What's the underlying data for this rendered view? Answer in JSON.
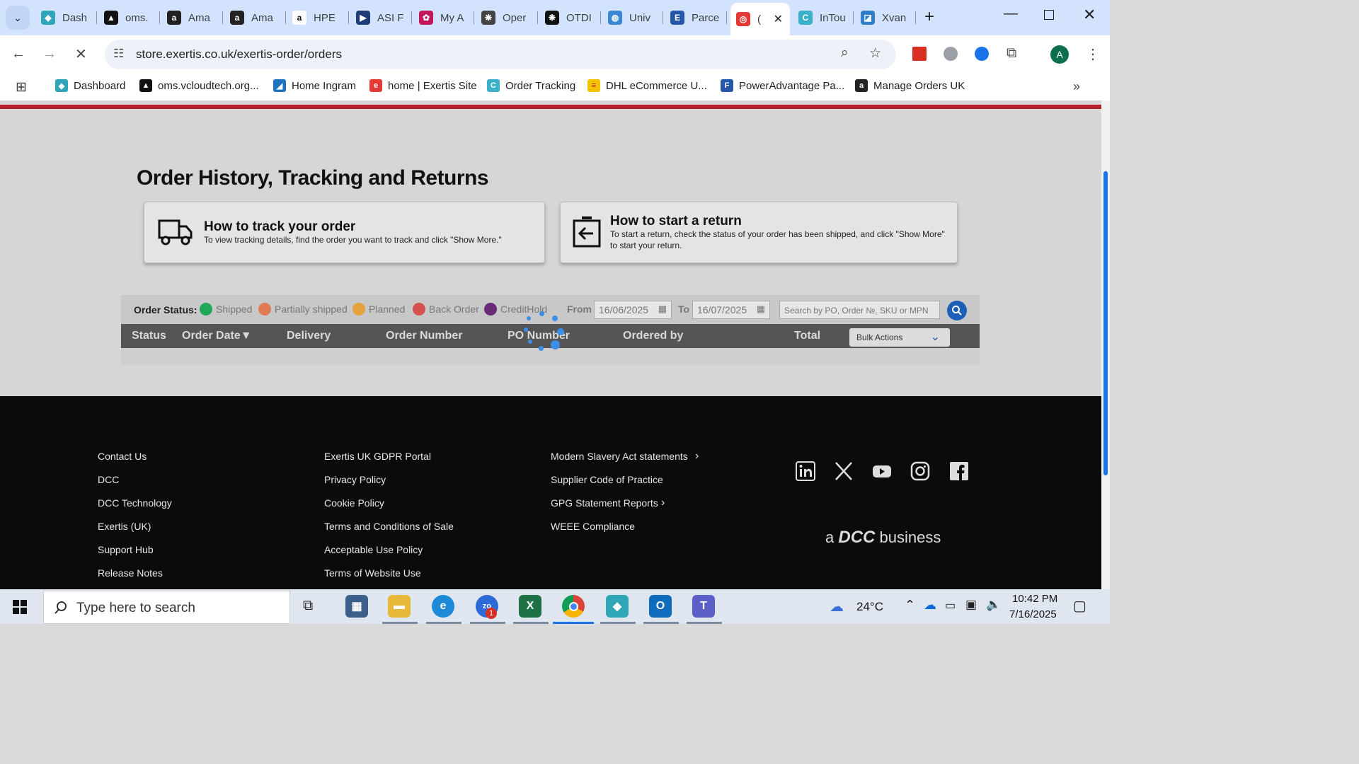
{
  "browser": {
    "tabs": [
      {
        "label": "Dash",
        "color": "#2fa6b8",
        "glyph": "◆"
      },
      {
        "label": "oms.",
        "color": "#111111",
        "glyph": "▲"
      },
      {
        "label": "Ama",
        "color": "#222222",
        "glyph": "a"
      },
      {
        "label": "Ama",
        "color": "#222222",
        "glyph": "a"
      },
      {
        "label": "HPE",
        "color": "#ffffff",
        "glyph": "a"
      },
      {
        "label": "ASI F",
        "color": "#1d3c78",
        "glyph": "▶"
      },
      {
        "label": "My A",
        "color": "#c2185b",
        "glyph": "✿"
      },
      {
        "label": "Oper",
        "color": "#444444",
        "glyph": "❋"
      },
      {
        "label": "OTDI",
        "color": "#111111",
        "glyph": "❋"
      },
      {
        "label": "Univ",
        "color": "#3b88d6",
        "glyph": "◍"
      },
      {
        "label": "Parce",
        "color": "#2556a8",
        "glyph": "E"
      },
      {
        "label": "(",
        "color": "#e53935",
        "glyph": "◎"
      },
      {
        "label": "InTou",
        "color": "#3ab0c9",
        "glyph": "C"
      },
      {
        "label": "Xvan",
        "color": "#2f7ec9",
        "glyph": "◪"
      }
    ],
    "active_tab_index": 11,
    "url": "store.exertis.co.uk/exertis-order/orders",
    "profile_initial": "A",
    "bookmarks": [
      {
        "label": "Dashboard",
        "color": "#2fa6b8",
        "glyph": "◆"
      },
      {
        "label": "oms.vcloudtech.org...",
        "color": "#111111",
        "glyph": "▲"
      },
      {
        "label": "Home Ingram",
        "color": "#1e73be",
        "glyph": "◢"
      },
      {
        "label": "home | Exertis Site",
        "color": "#e53935",
        "glyph": "e"
      },
      {
        "label": "Order Tracking",
        "color": "#3ab0c9",
        "glyph": "C"
      },
      {
        "label": "DHL eCommerce U...",
        "color": "#f5c400",
        "glyph": "≡"
      },
      {
        "label": "PowerAdvantage Pa...",
        "color": "#2556a8",
        "glyph": "F"
      },
      {
        "label": "Manage Orders UK",
        "color": "#222222",
        "glyph": "a"
      }
    ]
  },
  "page": {
    "title": "Order History, Tracking and Returns",
    "track_card": {
      "heading": "How to track your order",
      "text": "To view tracking details, find the order you want to track and click \"Show More.\""
    },
    "return_card": {
      "heading": "How to start a return",
      "text": "To start a return, check the status of your order has been shipped, and click \"Show More\" to start your return."
    },
    "filters": {
      "status_label": "Order Status:",
      "statuses": [
        {
          "label": "Shipped",
          "color": "#1fa85a"
        },
        {
          "label": "Partially shipped",
          "color": "#e07b55"
        },
        {
          "label": "Planned",
          "color": "#e3a23b"
        },
        {
          "label": "Back Order",
          "color": "#d4514f"
        },
        {
          "label": "CreditHold",
          "color": "#6a2a7a"
        }
      ],
      "from_label": "From",
      "from_value": "16/06/2025",
      "to_label": "To",
      "to_value": "16/07/2025",
      "search_placeholder": "Search by PO, Order №, SKU or MPN"
    },
    "table": {
      "columns": [
        "Status",
        "Order Date▼",
        "Delivery",
        "Order Number",
        "PO Number",
        "Ordered by",
        "Total"
      ],
      "bulk_actions": "Bulk Actions"
    },
    "footer": {
      "col1": [
        "Contact Us",
        "DCC",
        "DCC Technology",
        "Exertis (UK)",
        "Support Hub",
        "Release Notes"
      ],
      "col2": [
        "Exertis UK GDPR Portal",
        "Privacy Policy",
        "Cookie Policy",
        "Terms and Conditions of Sale",
        "Acceptable Use Policy",
        "Terms of Website Use"
      ],
      "col3": [
        "Modern Slavery Act statements",
        "Supplier Code of Practice",
        "GPG Statement Reports",
        "WEEE Compliance"
      ],
      "social": [
        "linkedin-icon",
        "x-icon",
        "youtube-icon",
        "instagram-icon",
        "facebook-icon"
      ],
      "tagline_a": "a",
      "tagline_dcc": "DCC",
      "tagline_rest": "business"
    }
  },
  "taskbar": {
    "search_placeholder": "Type here to search",
    "weather": "24°C",
    "time": "10:42 PM",
    "date": "7/16/2025",
    "zoom_badge": "1"
  }
}
